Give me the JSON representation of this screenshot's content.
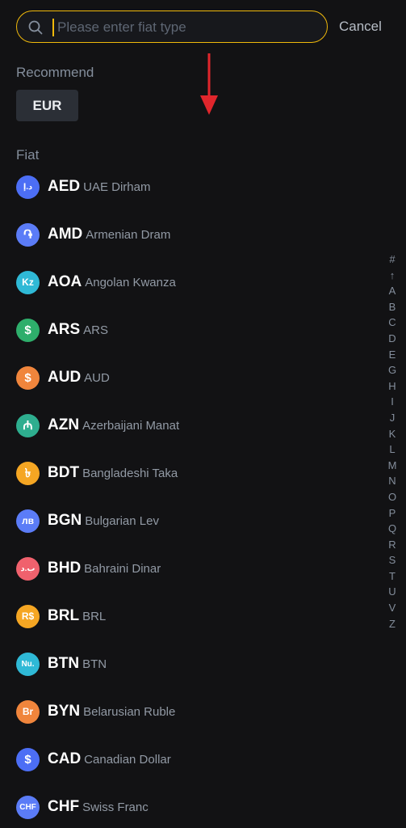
{
  "search": {
    "placeholder": "Please enter fiat type",
    "cancel_label": "Cancel"
  },
  "recommend": {
    "label": "Recommend",
    "chips": [
      "EUR"
    ]
  },
  "fiat": {
    "label": "Fiat",
    "items": [
      {
        "code": "AED",
        "name": "UAE Dirham",
        "icon_glyph": "د.إ",
        "icon_color": "#4c6ef5"
      },
      {
        "code": "AMD",
        "name": "Armenian Dram",
        "icon_glyph": "֏",
        "icon_color": "#5b7cf7"
      },
      {
        "code": "AOA",
        "name": "Angolan Kwanza",
        "icon_glyph": "Kz",
        "icon_color": "#2fb9d6"
      },
      {
        "code": "ARS",
        "name": "ARS",
        "icon_glyph": "$",
        "icon_color": "#2eae6b"
      },
      {
        "code": "AUD",
        "name": "AUD",
        "icon_glyph": "$",
        "icon_color": "#f0853c"
      },
      {
        "code": "AZN",
        "name": "Azerbaijani Manat",
        "icon_glyph": "₼",
        "icon_color": "#2eae8f"
      },
      {
        "code": "BDT",
        "name": "Bangladeshi Taka",
        "icon_glyph": "৳",
        "icon_color": "#f5a623"
      },
      {
        "code": "BGN",
        "name": "Bulgarian Lev",
        "icon_glyph": "лв",
        "icon_color": "#5b7cf7"
      },
      {
        "code": "BHD",
        "name": "Bahraini Dinar",
        "icon_glyph": "ب.د",
        "icon_color": "#f0616d"
      },
      {
        "code": "BRL",
        "name": "BRL",
        "icon_glyph": "R$",
        "icon_color": "#f5a623"
      },
      {
        "code": "BTN",
        "name": "BTN",
        "icon_glyph": "Nu.",
        "icon_color": "#2fb9d6"
      },
      {
        "code": "BYN",
        "name": "Belarusian Ruble",
        "icon_glyph": "Br",
        "icon_color": "#f0853c"
      },
      {
        "code": "CAD",
        "name": "Canadian Dollar",
        "icon_glyph": "$",
        "icon_color": "#4c6ef5"
      },
      {
        "code": "CHF",
        "name": "Swiss Franc",
        "icon_glyph": "CHF",
        "icon_color": "#5b7cf7"
      }
    ]
  },
  "alphabet_index": [
    "#",
    "↑",
    "A",
    "B",
    "C",
    "D",
    "E",
    "G",
    "H",
    "I",
    "J",
    "K",
    "L",
    "M",
    "N",
    "O",
    "P",
    "Q",
    "R",
    "S",
    "T",
    "U",
    "V",
    "Z"
  ],
  "colors": {
    "accent": "#f0b90b",
    "arrow": "#e0262c"
  }
}
